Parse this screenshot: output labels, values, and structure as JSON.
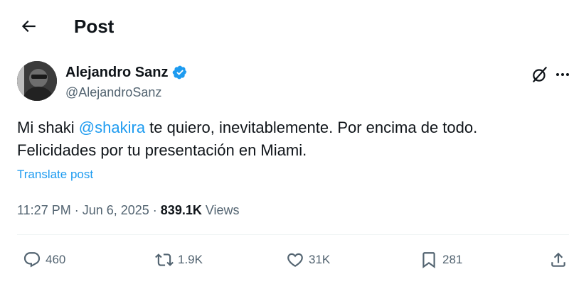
{
  "header": {
    "back_icon": "arrow-left-icon",
    "title": "Post"
  },
  "author": {
    "name": "Alejandro Sanz",
    "handle": "@AlejandroSanz",
    "verified_color": "#1d9bf0"
  },
  "post": {
    "text_before": "Mi shaki ",
    "mention": "@shakira",
    "text_after": " te quiero, inevitablemente. Por encima de todo. Felicidades por tu presentación en Miami.",
    "translate_label": "Translate post",
    "time": "11:27 PM",
    "separator": " · ",
    "date": "Jun 6, 2025",
    "views_count": "839.1K",
    "views_label": " Views"
  },
  "actions": {
    "replies": "460",
    "reposts": "1.9K",
    "likes": "31K",
    "bookmarks": "281"
  },
  "colors": {
    "accent": "#1d9bf0",
    "text": "#0f1419",
    "secondary": "#536471"
  }
}
